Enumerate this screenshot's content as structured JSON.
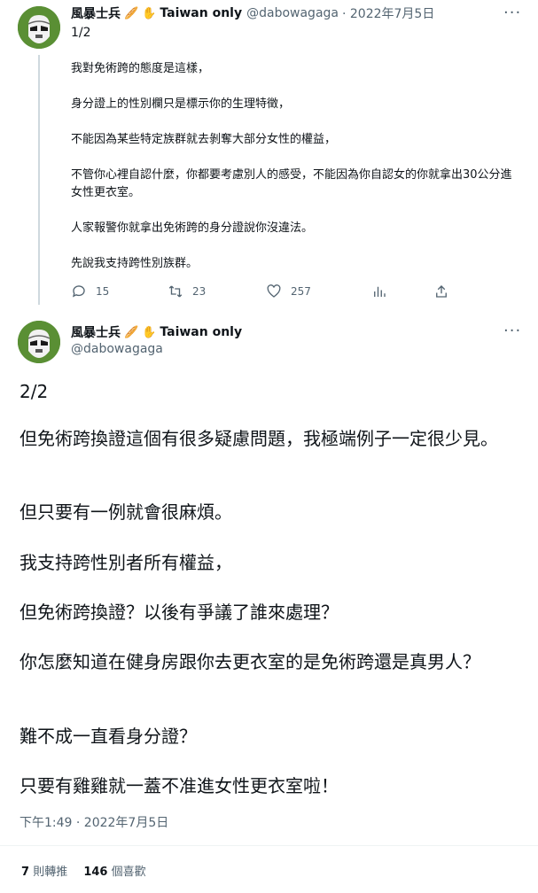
{
  "tweet1": {
    "author_name": "風暴士兵",
    "badge_text": "Taiwan only",
    "handle": "@dabowagaga",
    "date": "· 2022年7月5日",
    "counter": "1/2",
    "paragraphs": [
      "我對免術跨的態度是這樣，",
      "身分證上的性別欄只是標示你的生理特徵，",
      "不能因為某些特定族群就去剝奪大部分女性的權益，",
      "不管你心裡自認什麼，你都要考慮別人的感受，不能因為你自認女的你就拿出30公分進女性更衣室。",
      "人家報警你就拿出免術跨的身分證說你沒違法。",
      "先說我支持跨性別族群。"
    ],
    "reply_count": "15",
    "retweet_count": "23",
    "like_count": "257"
  },
  "tweet2": {
    "author_name": "風暴士兵",
    "badge_text": "Taiwan only",
    "handle": "@dabowagaga",
    "paragraphs": [
      "2/2",
      "但免術跨換證這個有很多疑慮問題，我極端例子一定很少見。",
      "但只要有一例就會很麻煩。",
      "我支持跨性別者所有權益，",
      "但免術跨換證？以後有爭議了誰來處理？",
      "你怎麼知道在健身房跟你去更衣室的是免術跨還是真男人？",
      "難不成一直看身分證？",
      "只要有雞雞就一蓋不准進女性更衣室啦！"
    ],
    "timestamp": "下午1:49 · 2022年7月5日",
    "retweets_num": "7",
    "retweets_label": "則轉推",
    "likes_num": "146",
    "likes_label": "個喜歡"
  }
}
